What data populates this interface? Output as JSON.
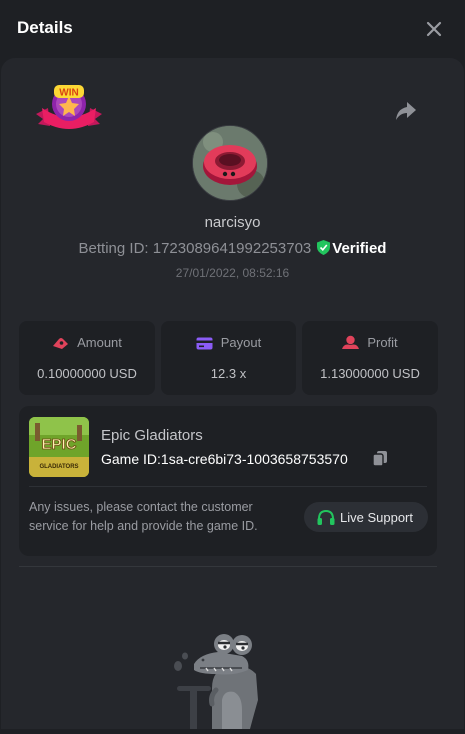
{
  "header": {
    "title": "Details",
    "close_icon": "close-icon"
  },
  "badge": {
    "text": "WIN"
  },
  "player": {
    "username": "narcisyo",
    "betting_id_label": "Betting ID:",
    "betting_id": "1723089641992253703",
    "verified_label": "Verified",
    "timestamp": "27/01/2022, 08:52:16"
  },
  "stats": [
    {
      "label": "Amount",
      "value": "0.10000000 USD",
      "icon": "amount-icon",
      "color": "#e0435b"
    },
    {
      "label": "Payout",
      "value": "12.3 x",
      "icon": "card-icon",
      "color": "#8b5cf6"
    },
    {
      "label": "Profit",
      "value": "1.13000000 USD",
      "icon": "profit-icon",
      "color": "#e0435b"
    }
  ],
  "game": {
    "name": "Epic Gladiators",
    "id_label": "Game ID:",
    "id_value": "1sa-cre6bi73-1003658753570",
    "thumb_title": "EPIC",
    "thumb_subtitle": "GLADIATORS",
    "help_text": "Any issues, please contact the customer service for help and provide the game ID.",
    "support_label": "Live Support"
  },
  "colors": {
    "verified": "#22c55e",
    "support_icon": "#22c55e"
  }
}
